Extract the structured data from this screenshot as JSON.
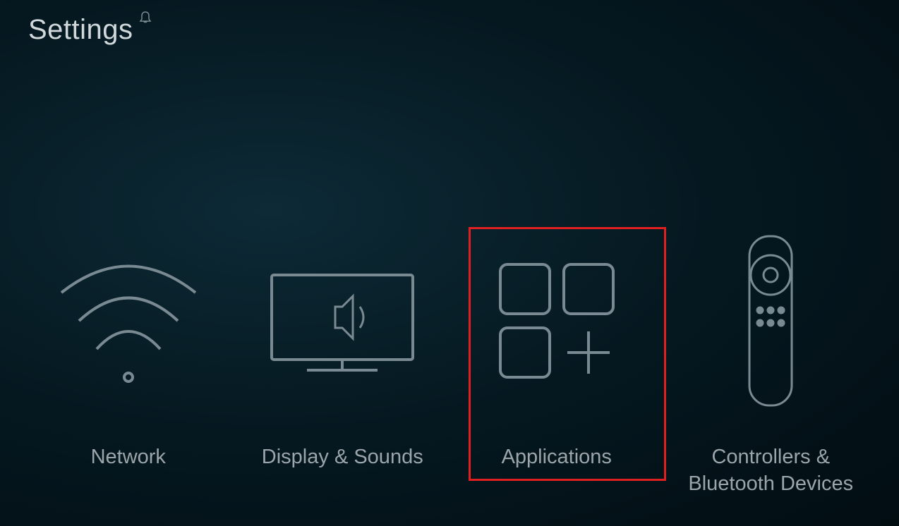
{
  "header": {
    "title": "Settings"
  },
  "items": [
    {
      "label": "Network",
      "icon": "wifi"
    },
    {
      "label": "Display & Sounds",
      "icon": "display-sound"
    },
    {
      "label": "Applications",
      "icon": "apps",
      "highlighted": true
    },
    {
      "label": "Controllers & Bluetooth Devices",
      "icon": "remote"
    }
  ]
}
